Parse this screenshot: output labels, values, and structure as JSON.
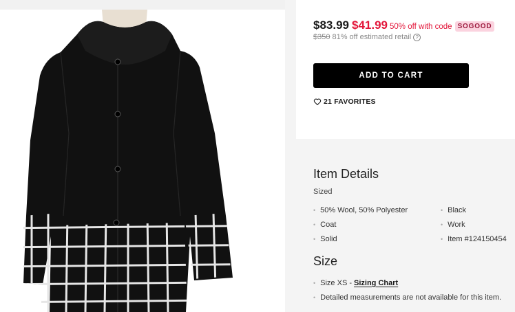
{
  "pricing": {
    "original_price": "$83.99",
    "sale_price": "$41.99",
    "discount_text": "50% off with code",
    "promo_code": "SOGOOD",
    "retail_price": "$350",
    "retail_text": "81% off estimated retail",
    "help_icon": "?"
  },
  "actions": {
    "add_to_cart_label": "ADD TO CART",
    "favorites_label": "21 FAVORITES",
    "favorites_icon": "heart-outline-icon"
  },
  "item_details": {
    "title": "Item Details",
    "sized_label": "Sized",
    "attributes_left": [
      "50% Wool, 50% Polyester",
      "Coat",
      "Solid"
    ],
    "attributes_right": [
      "Black",
      "Work",
      "Item #124150454"
    ]
  },
  "size": {
    "title": "Size",
    "size_value": "Size XS -",
    "sizing_chart_label": "Sizing Chart",
    "measurements_note": "Detailed measurements are not available for this item."
  },
  "colors": {
    "sale_red": "#e3163a",
    "promo_badge_bg": "#fbd3df",
    "button_black": "#000000",
    "panel_gray": "#f4f4f4"
  }
}
